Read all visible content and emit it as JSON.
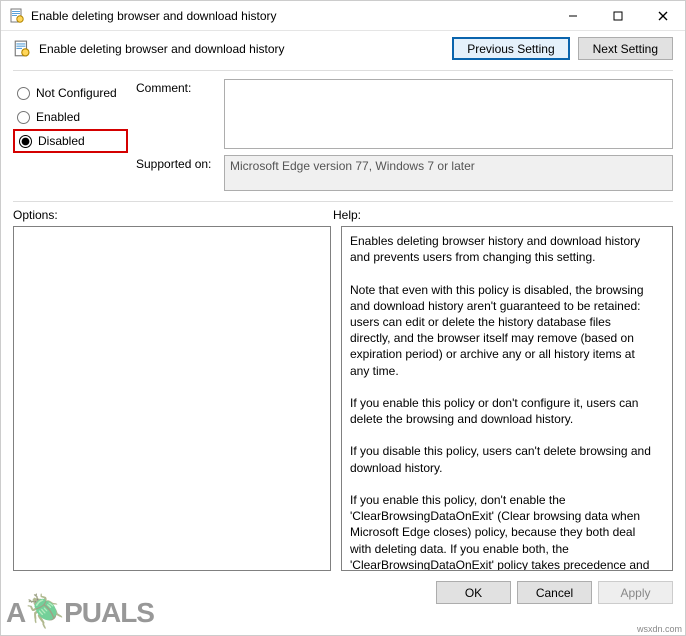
{
  "titlebar": {
    "title": "Enable deleting browser and download history"
  },
  "header": {
    "policy_title": "Enable deleting browser and download history",
    "prev_label": "Previous Setting",
    "next_label": "Next Setting"
  },
  "radios": {
    "not_configured": "Not Configured",
    "enabled": "Enabled",
    "disabled": "Disabled",
    "selected": "disabled"
  },
  "fields": {
    "comment_label": "Comment:",
    "comment_value": "",
    "supported_label": "Supported on:",
    "supported_value": "Microsoft Edge version 77, Windows 7 or later"
  },
  "options": {
    "label": "Options:",
    "content": ""
  },
  "help": {
    "label": "Help:",
    "content": "Enables deleting browser history and download history and prevents users from changing this setting.\n\nNote that even with this policy is disabled, the browsing and download history aren't guaranteed to be retained: users can edit or delete the history database files directly, and the browser itself may remove (based on expiration period) or archive any or all history items at any time.\n\nIf you enable this policy or don't configure it, users can delete the browsing and download history.\n\nIf you disable this policy, users can't delete browsing and download history.\n\nIf you enable this policy, don't enable the 'ClearBrowsingDataOnExit' (Clear browsing data when Microsoft Edge closes) policy, because they both deal with deleting data. If you enable both, the 'ClearBrowsingDataOnExit' policy takes precedence and deletes all data when Microsoft Edge closes, regardless of how this policy is configured."
  },
  "footer": {
    "ok": "OK",
    "cancel": "Cancel",
    "apply": "Apply"
  },
  "watermark": {
    "brand_pre": "A",
    "brand_accent": "🪲",
    "brand_post": "PUALS"
  },
  "corner": "wsxdn.com"
}
